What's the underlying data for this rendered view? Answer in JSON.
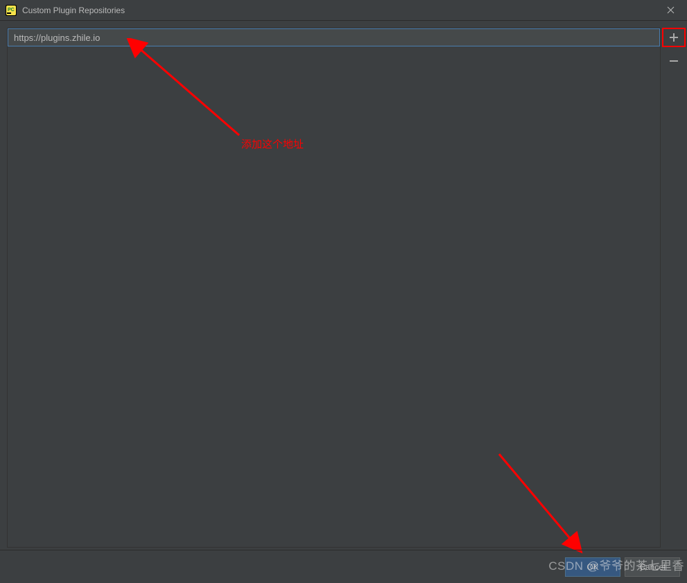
{
  "window": {
    "title": "Custom Plugin Repositories"
  },
  "input": {
    "value": "https://plugins.zhile.io"
  },
  "side": {
    "add_icon": "plus-icon",
    "remove_icon": "minus-icon"
  },
  "annotations": {
    "top_text": "添加这个地址"
  },
  "footer": {
    "ok_label": "OK",
    "cancel_label": "Cancel"
  },
  "watermark": "CSDN @爷爷的茶七里香"
}
